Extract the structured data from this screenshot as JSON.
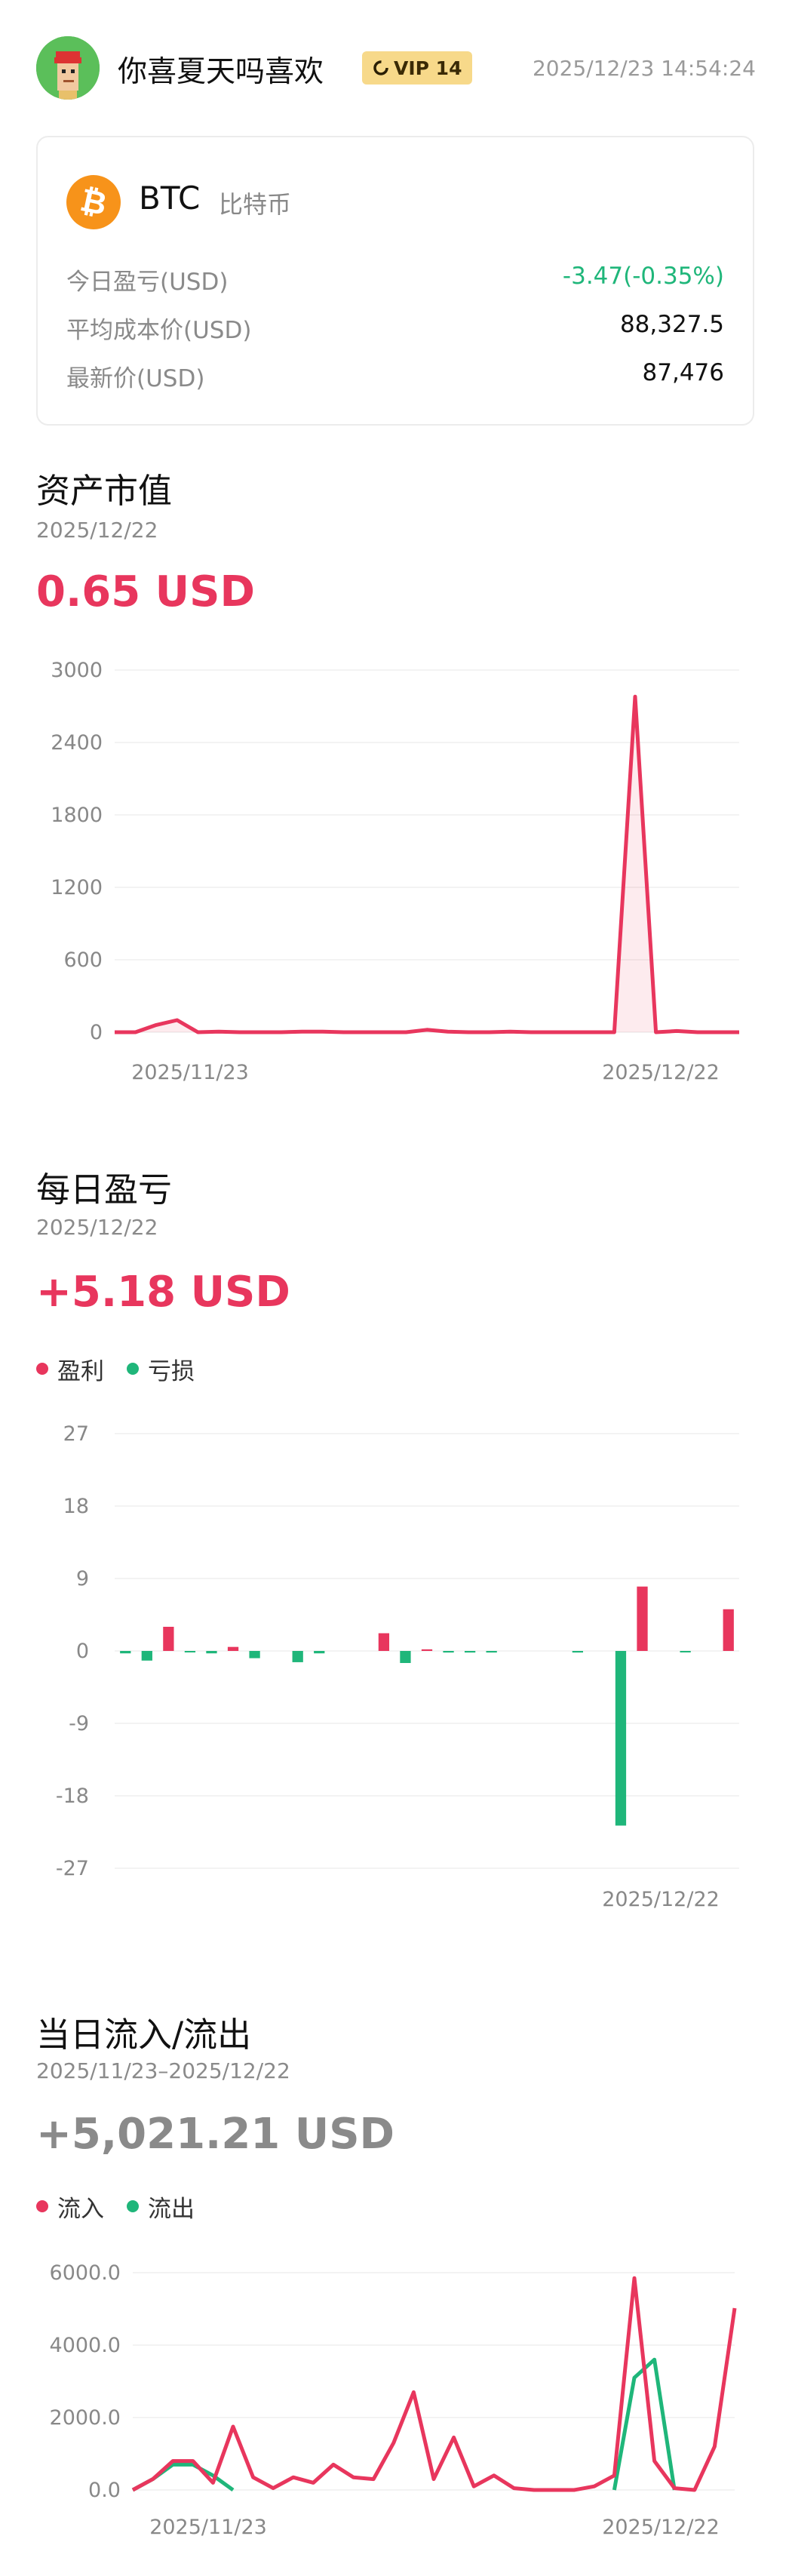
{
  "header": {
    "username": "你喜夏天吗喜欢",
    "vip_label": "VIP 14",
    "timestamp": "2025/12/23 14:54:24",
    "avatar_icon": "pixel-avatar-icon",
    "vip_icon": "vip-ring-icon"
  },
  "asset_card": {
    "symbol": "BTC",
    "name": "比特币",
    "coin_icon": "bitcoin-icon",
    "rows": [
      {
        "label": "今日盈亏(USD)",
        "value": "-3.47(-0.35%)"
      },
      {
        "label": "平均成本价(USD)",
        "value": "88,327.5"
      },
      {
        "label": "最新价(USD)",
        "value": "87,476"
      }
    ]
  },
  "market_value": {
    "title": "资产市值",
    "date": "2025/12/22",
    "value": "0.65 USD"
  },
  "daily_pnl": {
    "title": "每日盈亏",
    "date": "2025/12/22",
    "value": "+5.18 USD",
    "legend": [
      "盈利",
      "亏损"
    ]
  },
  "flow": {
    "title": "当日流入/流出",
    "date_range": "2025/11/23–2025/12/22",
    "value": "+5,021.21 USD",
    "legend": [
      "流入",
      "流出"
    ]
  },
  "colors": {
    "red": "#e8365d",
    "green": "#1fb67a",
    "bitcoin": "#f7931a",
    "vip": "#f7d98a"
  },
  "chart_data": [
    {
      "type": "area",
      "yticks": [
        "3000",
        "2400",
        "1800",
        "1200",
        "600",
        "0"
      ],
      "xticks": [
        "2025/11/23",
        "2025/12/22"
      ],
      "ylim": [
        0,
        3000
      ],
      "grid": true,
      "series": [
        {
          "values": [
            0,
            0,
            60,
            100,
            0,
            5,
            0,
            0,
            0,
            5,
            5,
            0,
            0,
            0,
            0,
            20,
            5,
            0,
            0,
            5,
            0,
            0,
            0,
            0,
            0,
            2780,
            0,
            10,
            0,
            0,
            0
          ]
        }
      ]
    },
    {
      "type": "bar",
      "yticks": [
        "27",
        "18",
        "9",
        "0",
        "-9",
        "-18",
        "-27"
      ],
      "xticks": [
        "2025/12/22"
      ],
      "ylim": [
        -27,
        27
      ],
      "grid": true,
      "series": [
        {
          "name": "盈利",
          "values": [
            0,
            0,
            3.0,
            0,
            0,
            0.5,
            0,
            0,
            0,
            0,
            0,
            0,
            2.2,
            0,
            0.2,
            0,
            0,
            0,
            0,
            0,
            0,
            0,
            0,
            0,
            8.0,
            0,
            0,
            0,
            5.18
          ]
        },
        {
          "name": "亏损",
          "values": [
            -0.3,
            -1.2,
            0,
            -0.1,
            -0.3,
            0,
            -0.9,
            0,
            -1.4,
            -0.3,
            0,
            0,
            0,
            -1.5,
            0,
            -0.2,
            -0.2,
            -0.2,
            0,
            0,
            0,
            -0.2,
            0,
            -21.7,
            0,
            0,
            -0.1,
            0,
            0
          ]
        }
      ]
    },
    {
      "type": "line",
      "yticks": [
        "6000.0",
        "4000.0",
        "2000.0",
        "0.0"
      ],
      "xticks": [
        "2025/11/23",
        "2025/12/22"
      ],
      "ylim": [
        0,
        6000
      ],
      "grid": true,
      "series": [
        {
          "name": "流入",
          "values": [
            0,
            300,
            800,
            800,
            200,
            1750,
            350,
            50,
            350,
            200,
            700,
            350,
            300,
            1300,
            2700,
            300,
            1450,
            100,
            400,
            50,
            0,
            0,
            0,
            100,
            400,
            5850,
            800,
            50,
            0,
            1200,
            5021
          ]
        },
        {
          "name": "流出",
          "values": [
            0,
            300,
            700,
            700,
            400,
            0,
            0,
            0,
            0,
            0,
            0,
            0,
            0,
            0,
            0,
            0,
            0,
            0,
            0,
            0,
            0,
            0,
            0,
            0,
            0,
            3100,
            3600,
            0,
            0,
            0,
            0
          ]
        }
      ]
    }
  ]
}
